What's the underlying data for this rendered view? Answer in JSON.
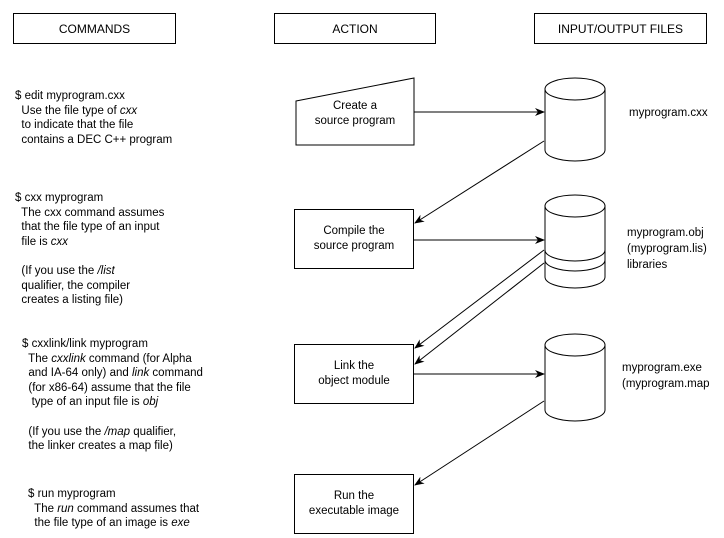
{
  "headers": {
    "commands": "COMMANDS",
    "action": "ACTION",
    "files": "INPUT/OUTPUT FILES"
  },
  "commands": [
    {
      "lines": [
        [
          {
            "t": "$ edit myprogram.cxx"
          }
        ],
        [
          {
            "t": "  Use the file type of "
          },
          {
            "t": "cxx",
            "i": true
          }
        ],
        [
          {
            "t": "  to indicate that the file"
          }
        ],
        [
          {
            "t": "  contains a DEC C++ program"
          }
        ]
      ]
    },
    {
      "lines": [
        [
          {
            "t": "$ cxx myprogram"
          }
        ],
        [
          {
            "t": "  The cxx command assumes"
          }
        ],
        [
          {
            "t": "  that the file type of an input"
          }
        ],
        [
          {
            "t": "  file is "
          },
          {
            "t": "cxx",
            "i": true
          }
        ],
        [
          {
            "t": " "
          }
        ],
        [
          {
            "t": "  (If you use the "
          },
          {
            "t": "/list",
            "i": true
          }
        ],
        [
          {
            "t": "  qualifier, the compiler"
          }
        ],
        [
          {
            "t": "  creates a listing file)"
          }
        ]
      ]
    },
    {
      "lines": [
        [
          {
            "t": "$ cxxlink/link myprogram"
          }
        ],
        [
          {
            "t": "  The "
          },
          {
            "t": "cxxlink",
            "i": true
          },
          {
            "t": " command (for Alpha"
          }
        ],
        [
          {
            "t": "  and IA-64 only) and "
          },
          {
            "t": "link",
            "i": true
          },
          {
            "t": " command"
          }
        ],
        [
          {
            "t": "  (for x86-64) assume that the file"
          }
        ],
        [
          {
            "t": "   type of an input file is "
          },
          {
            "t": "obj",
            "i": true
          }
        ],
        [
          {
            "t": " "
          }
        ],
        [
          {
            "t": "  (If you use the "
          },
          {
            "t": "/map",
            "i": true
          },
          {
            "t": " qualifier,"
          }
        ],
        [
          {
            "t": "  the linker creates a map file)"
          }
        ]
      ]
    },
    {
      "lines": [
        [
          {
            "t": "$ run myprogram"
          }
        ],
        [
          {
            "t": "  The "
          },
          {
            "t": "run",
            "i": true
          },
          {
            "t": " command assumes that"
          }
        ],
        [
          {
            "t": "  the file type of an image is "
          },
          {
            "t": "exe",
            "i": true
          }
        ]
      ]
    }
  ],
  "actions": [
    {
      "line1": "Create a",
      "line2": "source program"
    },
    {
      "line1": "Compile the",
      "line2": "source program"
    },
    {
      "line1": "Link the",
      "line2": "object module"
    },
    {
      "line1": "Run the",
      "line2": "executable image"
    }
  ],
  "files": [
    {
      "lines": [
        "myprogram.cxx"
      ]
    },
    {
      "lines": [
        "myprogram.obj",
        "(myprogram.lis)",
        "libraries"
      ]
    },
    {
      "lines": [
        "myprogram.exe",
        "(myprogram.map"
      ]
    }
  ]
}
